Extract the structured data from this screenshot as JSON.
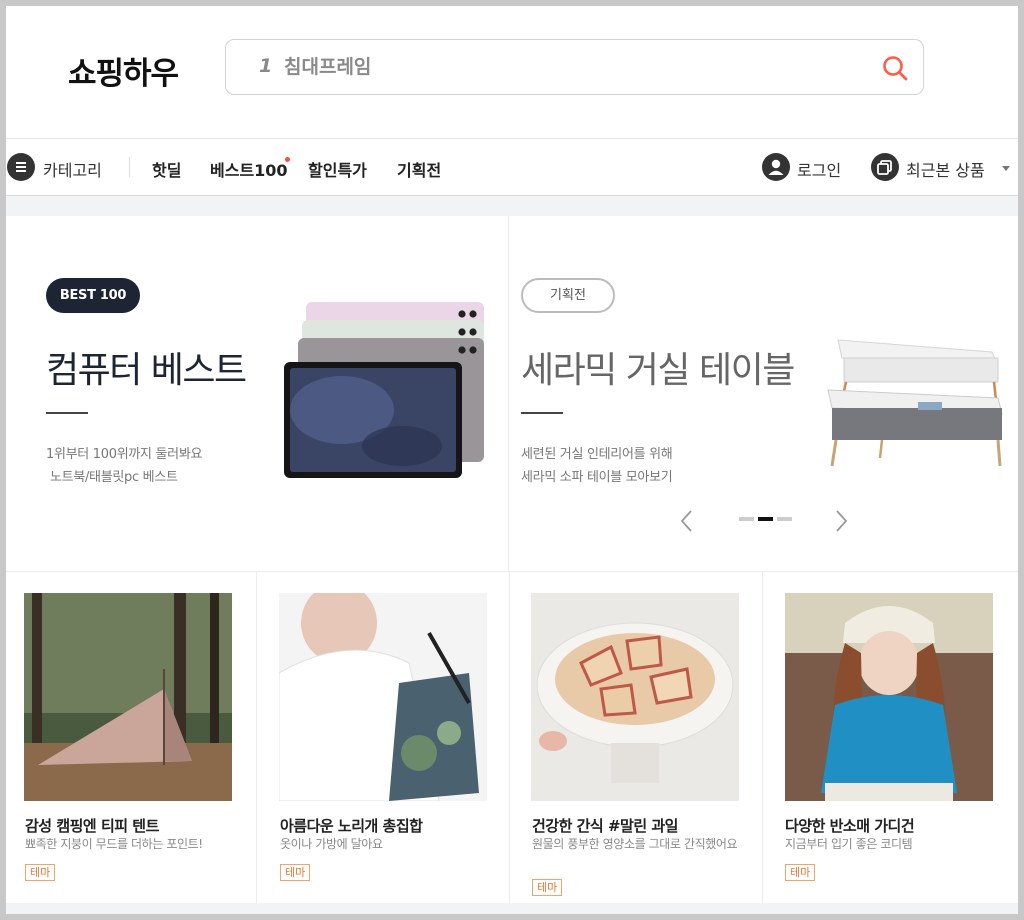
{
  "header": {
    "logo": "쇼핑하우",
    "search": {
      "rank": "1",
      "placeholder": "침대프레임",
      "icon": "search-icon"
    }
  },
  "nav": {
    "category_label": "카테고리",
    "items": [
      {
        "label": "핫딜"
      },
      {
        "label": "베스트100",
        "new_dot": true
      },
      {
        "label": "할인특가"
      },
      {
        "label": "기획전"
      }
    ],
    "login_label": "로그인",
    "recent_label": "최근본 상품"
  },
  "banners": [
    {
      "badge": "BEST 100",
      "title": "컴퓨터 베스트",
      "desc_line1": "1위부터 100위까지 둘러봐요",
      "desc_line2": "노트북/태블릿pc 베스트"
    },
    {
      "badge": "기획전",
      "title": "세라믹 거실 테이블",
      "desc_line1": "세련된 거실 인테리어를 위해",
      "desc_line2": "세라믹 소파 테이블 모아보기"
    }
  ],
  "carousel": {
    "active_index": 1,
    "count": 3
  },
  "cards": [
    {
      "title": "감성 캠핑엔 티피 텐트",
      "desc": "뾰족한 지붕이 무드를 더하는 포인트!",
      "tag": "테마"
    },
    {
      "title": "아름다운 노리개 총집합",
      "desc": "옷이나 가방에 달아요",
      "tag": "테마"
    },
    {
      "title": "건강한 간식 #말린 과일",
      "desc": "원물의 풍부한 영양소를 그대로 간직했어요",
      "tag": "테마"
    },
    {
      "title": "다양한 반소매 가디건",
      "desc": "지금부터 입기 좋은 코디템",
      "tag": "테마"
    }
  ],
  "colors": {
    "accent": "#ff5a4a",
    "badge_dark": "#1d2433",
    "tag": "#e27a34"
  }
}
